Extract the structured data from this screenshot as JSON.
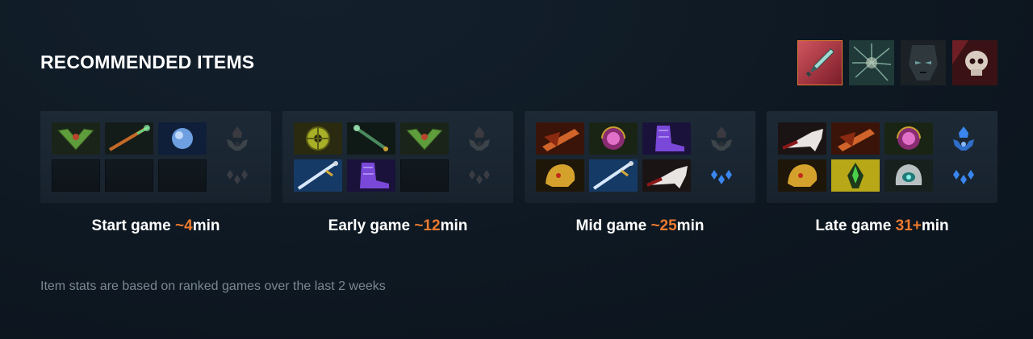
{
  "title": "RECOMMENDED ITEMS",
  "colors": {
    "accent": "#ec7a2f",
    "background": "#0e1822",
    "panel": "#1b2834",
    "active_tab_border": "#e87b35"
  },
  "skill_tabs": [
    {
      "icon": "dagger-skill-icon",
      "active": true
    },
    {
      "icon": "shatter-skill-icon",
      "active": false
    },
    {
      "icon": "dark-face-skill-icon",
      "active": false
    },
    {
      "icon": "skull-skill-icon",
      "active": false
    }
  ],
  "phases": [
    {
      "label_prefix": "Start game ",
      "label_value": "~4",
      "label_suffix": "min",
      "items": [
        "green-wings-item",
        "magic-wand-item",
        "crystal-orb-item",
        "empty",
        "empty",
        "empty"
      ],
      "neutral_active": false,
      "aghs_active": false
    },
    {
      "label_prefix": "Early game ",
      "label_value": "~12",
      "label_suffix": "min",
      "items": [
        "yellow-disk-item",
        "jade-staff-item",
        "green-wings-item",
        "glowing-blade-item",
        "violet-boots-item",
        "empty"
      ],
      "neutral_active": false,
      "aghs_active": false
    },
    {
      "label_prefix": "Mid game ",
      "label_value": "~25",
      "label_suffix": "min",
      "items": [
        "orange-shield-item",
        "pink-orb-item",
        "violet-boots-item",
        "golden-helm-item",
        "glowing-blade-item",
        "serrated-blade-item"
      ],
      "neutral_active": false,
      "aghs_active": true
    },
    {
      "label_prefix": "Late game ",
      "label_value": "31+",
      "label_suffix": "min",
      "items": [
        "serrated-blade-item",
        "orange-shield-item",
        "pink-orb-item",
        "golden-helm-item",
        "green-claw-item",
        "silver-helm-item"
      ],
      "neutral_active": true,
      "aghs_active": true
    }
  ],
  "footnote": "Item stats are based on ranked games over the last 2 weeks"
}
